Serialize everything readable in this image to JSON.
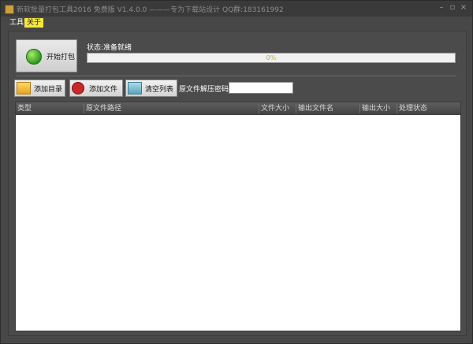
{
  "window": {
    "title": "新软批量打包工具2016 免费版 V1.4.0.0 ———专为下载站设计 QQ群:183161992",
    "controls": [
      "–",
      "▫",
      "×"
    ]
  },
  "menu": {
    "items": [
      "工具",
      "关于"
    ],
    "active_index": 1
  },
  "pack": {
    "start_label": "开始打包",
    "status_text": "状态:准备就绪",
    "progress_value": 0,
    "progress_text": "0%"
  },
  "toolbar": {
    "add_dir_label": "添加目录",
    "add_file_label": "添加文件",
    "clear_label": "清空列表",
    "password_label": "原文件解压密码",
    "password_value": ""
  },
  "table": {
    "columns": [
      "类型",
      "原文件路径",
      "文件大小",
      "输出文件名",
      "输出大小",
      "处理状态"
    ],
    "rows": []
  },
  "colors": {
    "window_bg": "#474747",
    "menu_active": "#f5e642",
    "accent_green": "#2f9a1e"
  },
  "icons": {
    "start": "green-start-icon",
    "add_dir": "folder-icon",
    "add_file": "file-icon",
    "clear": "clear-list-icon"
  }
}
